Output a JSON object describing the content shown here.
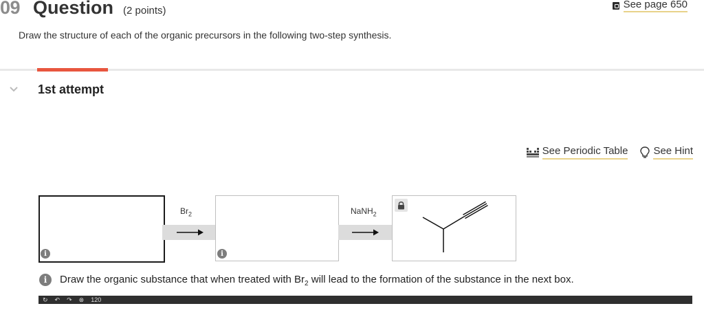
{
  "header": {
    "question_number": "09",
    "question_word": "Question",
    "points": "(2 points)",
    "see_page": "See page 650"
  },
  "instruction": "Draw the structure of each of the organic precursors in the following two-step synthesis.",
  "attempt": {
    "label": "1st attempt"
  },
  "links": {
    "periodic_table": "See Periodic Table",
    "hint": "See Hint"
  },
  "scheme": {
    "step1_reagent_base": "Br",
    "step1_reagent_sub": "2",
    "step2_reagent_base": "NaNH",
    "step2_reagent_sub": "2"
  },
  "feedback": {
    "text_before": "Draw the organic substance that when treated with Br",
    "sub": "2",
    "text_after": " will lead to the formation of the substance in the next box."
  },
  "toolbar": {
    "zoom_label": "120"
  },
  "icons": {
    "info": "info-icon",
    "lock": "lock-icon",
    "ebook": "ebook-icon",
    "periodic": "periodic-table-icon",
    "hint": "lightbulb-icon",
    "chevron": "chevron-down-icon"
  },
  "colors": {
    "accent": "#e8563f",
    "link_underline": "#e8d28a",
    "info_icon": "#7d7d7d"
  }
}
